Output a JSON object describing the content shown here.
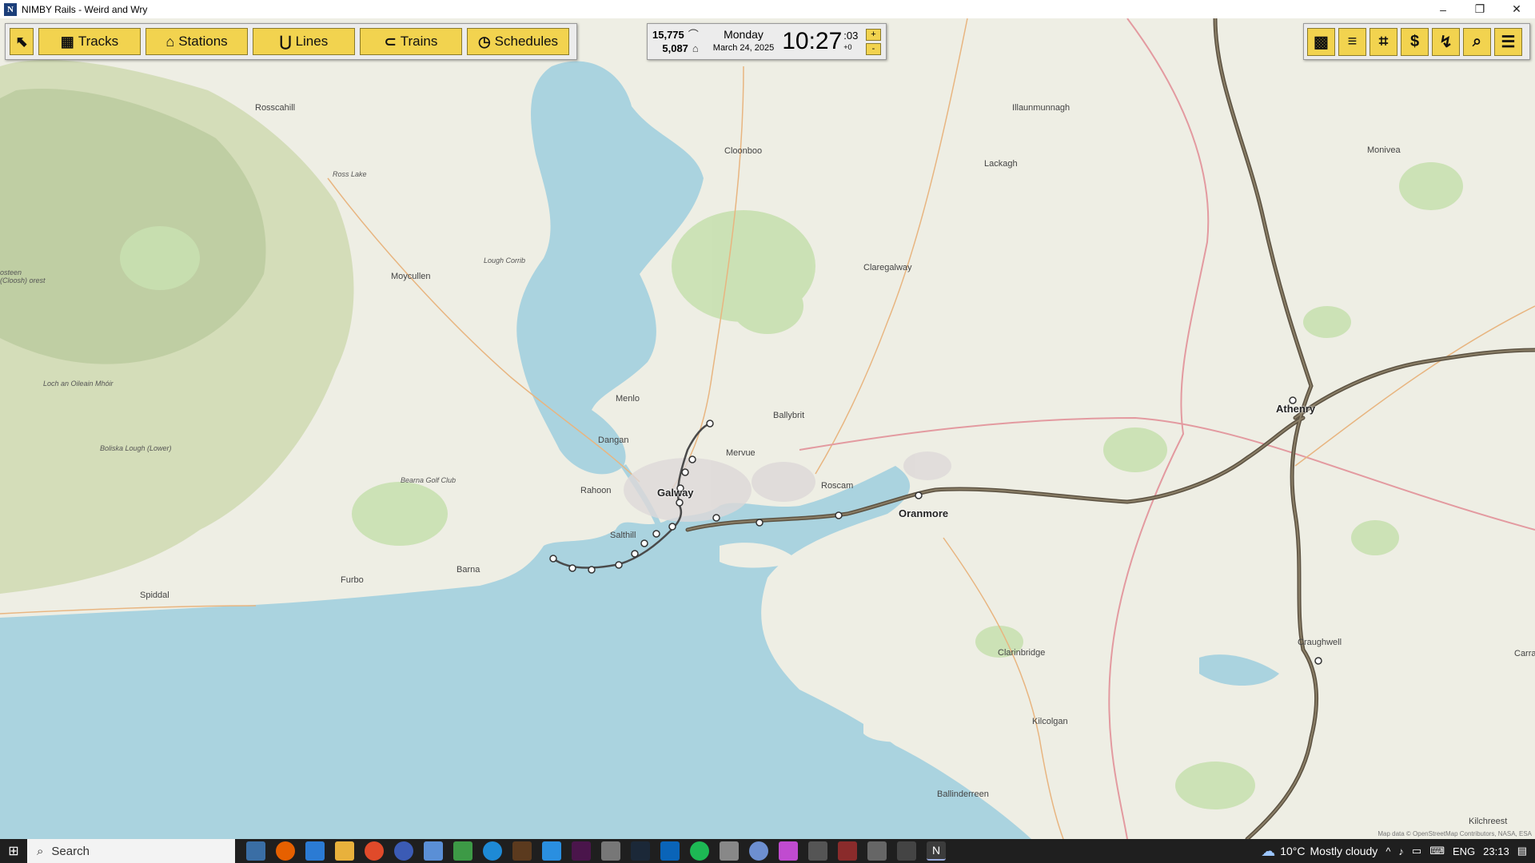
{
  "window": {
    "title": "NIMBY Rails - Weird and Wry",
    "app_icon": "N",
    "controls": {
      "minimize": "–",
      "restore": "❐",
      "close": "✕"
    }
  },
  "modes": {
    "cursor_icon": "cursor-icon",
    "buttons": [
      {
        "label": "Tracks",
        "icon": "tracks-icon"
      },
      {
        "label": "Stations",
        "icon": "stations-icon"
      },
      {
        "label": "Lines",
        "icon": "lines-icon"
      },
      {
        "label": "Trains",
        "icon": "trains-icon"
      },
      {
        "label": "Schedules",
        "icon": "schedules-icon"
      }
    ]
  },
  "clock": {
    "passengers": "15,775",
    "stations_count": "5,087",
    "weekday": "Monday",
    "date": "March 24, 2025",
    "time": "10:27",
    "seconds": ":03",
    "offset": "+0",
    "speed_up": "+",
    "speed_down": "-"
  },
  "tools": [
    "map-layers-icon",
    "sort-icon",
    "tag-icon",
    "dollar-icon",
    "signal-icon",
    "search-icon",
    "menu-icon"
  ],
  "map": {
    "places": [
      {
        "name": "Rosscahill",
        "cls": ""
      },
      {
        "name": "Cloonboo",
        "cls": ""
      },
      {
        "name": "Illaunmunnagh",
        "cls": ""
      },
      {
        "name": "Lackagh",
        "cls": ""
      },
      {
        "name": "Monivea",
        "cls": ""
      },
      {
        "name": "Ross Lake",
        "cls": "small"
      },
      {
        "name": "Claregalway",
        "cls": ""
      },
      {
        "name": "Moycullen",
        "cls": ""
      },
      {
        "name": "Lough Corrib",
        "cls": "small"
      },
      {
        "name": "Loch an Oileain Mhóir",
        "cls": "small"
      },
      {
        "name": "Boliska Lough (Lower)",
        "cls": "small"
      },
      {
        "name": "Menlo",
        "cls": ""
      },
      {
        "name": "Ballybrit",
        "cls": ""
      },
      {
        "name": "Athenry",
        "cls": "big"
      },
      {
        "name": "Dangan",
        "cls": ""
      },
      {
        "name": "Mervue",
        "cls": ""
      },
      {
        "name": "Bearna Golf Club",
        "cls": "small"
      },
      {
        "name": "Rahoon",
        "cls": ""
      },
      {
        "name": "Galway",
        "cls": "big"
      },
      {
        "name": "Roscam",
        "cls": ""
      },
      {
        "name": "Oranmore",
        "cls": "big"
      },
      {
        "name": "Salthill",
        "cls": ""
      },
      {
        "name": "Barna",
        "cls": ""
      },
      {
        "name": "Furbo",
        "cls": ""
      },
      {
        "name": "Spiddal",
        "cls": ""
      },
      {
        "name": "Craughwell",
        "cls": ""
      },
      {
        "name": "Clarinbridge",
        "cls": ""
      },
      {
        "name": "Kilcolgan",
        "cls": ""
      },
      {
        "name": "Ballinderreen",
        "cls": ""
      },
      {
        "name": "Kilchreest",
        "cls": ""
      },
      {
        "name": "Carra",
        "cls": ""
      },
      {
        "name": "osteen (Cloosh) orest",
        "cls": "small"
      }
    ],
    "attribution": "Map data © OpenStreetMap Contributors, NASA, ESA"
  },
  "taskbar": {
    "search_label": "Search",
    "apps": [
      "widgets-icon",
      "firefox-icon",
      "vscode-icon",
      "folder-icon",
      "fire-icon",
      "s-app-icon",
      "notes-icon",
      "green-app-icon",
      "edge-icon",
      "minecraft-icon",
      "blue-app-icon",
      "slack-icon",
      "controller-icon",
      "steam-icon",
      "outlook-icon",
      "spotify-icon",
      "game-icon",
      "chat-icon",
      "colorful-icon",
      "settings-icon",
      "x-app-icon",
      "box-icon",
      "usb-icon",
      "nimby-icon"
    ],
    "weather_temp": "10°C",
    "weather_text": "Mostly cloudy",
    "language": "ENG",
    "time": "23:13"
  }
}
